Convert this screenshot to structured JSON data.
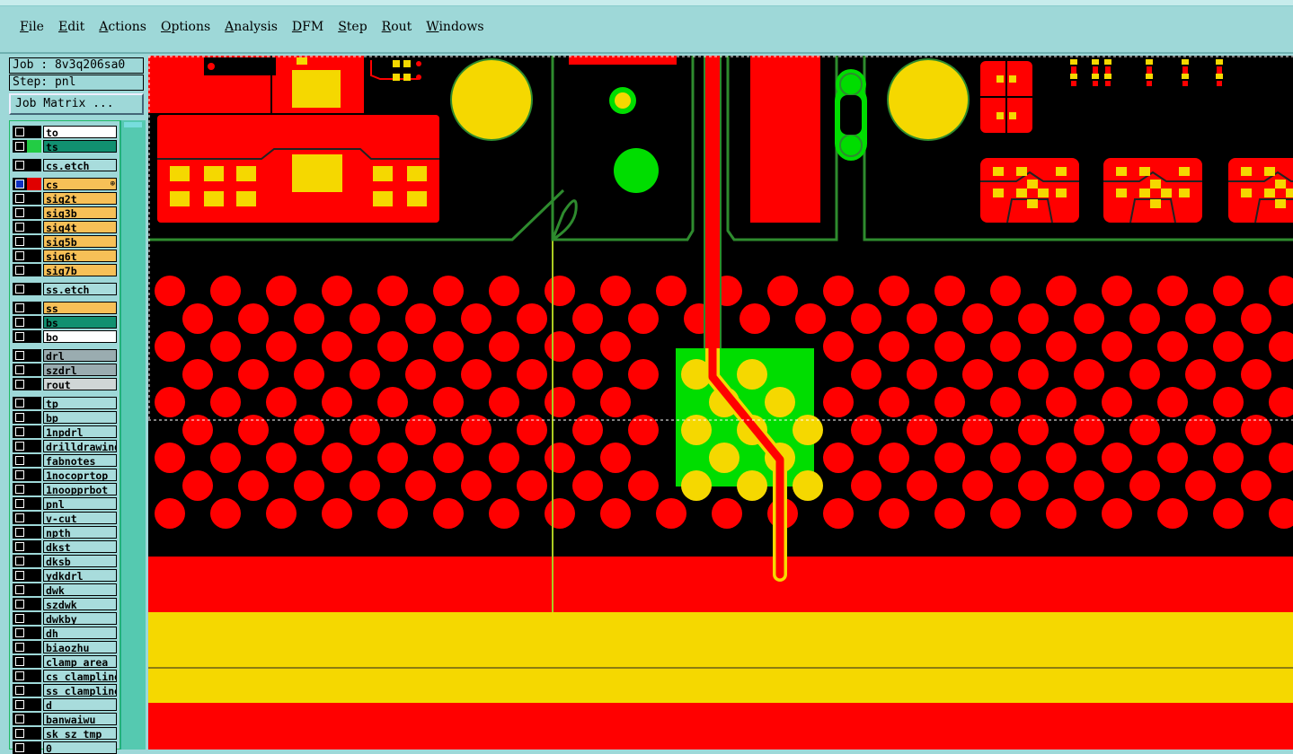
{
  "colors": {
    "copper_red": "#ff0000",
    "pad_yellow": "#f5d800",
    "mask_green": "#00dd00",
    "outline_green": "#2e8b2e",
    "background": "#000000",
    "ui_cyan": "#9ed8d8"
  },
  "menu": [
    "File",
    "Edit",
    "Actions",
    "Options",
    "Analysis",
    "DFM",
    "Step",
    "Rout",
    "Windows"
  ],
  "job": {
    "label": "Job : 8v3q206sa0",
    "step": "Step: pnl",
    "matrix_button": "Job Matrix ..."
  },
  "layers": [
    {
      "name": "to",
      "color": "white"
    },
    {
      "name": "ts",
      "color": "green",
      "swatch": "#22cc44"
    },
    {
      "name": "cs.etch",
      "color": "cyan"
    },
    {
      "name": "cs",
      "color": "orange",
      "swatch": "#e00000",
      "active": true,
      "flag": "⊕"
    },
    {
      "name": "sig2t",
      "color": "orange"
    },
    {
      "name": "sig3b",
      "color": "orange"
    },
    {
      "name": "sig4t",
      "color": "orange"
    },
    {
      "name": "sig5b",
      "color": "orange"
    },
    {
      "name": "sig6t",
      "color": "orange"
    },
    {
      "name": "sig7b",
      "color": "orange"
    },
    {
      "name": "ss.etch",
      "color": "cyan"
    },
    {
      "name": "ss",
      "color": "orange"
    },
    {
      "name": "bs",
      "color": "green"
    },
    {
      "name": "bo",
      "color": "white"
    },
    {
      "name": "drl",
      "color": "gray"
    },
    {
      "name": "szdrl",
      "color": "gray"
    },
    {
      "name": "rout",
      "color": "lgray"
    },
    {
      "name": "tp",
      "color": "cyan"
    },
    {
      "name": "bp",
      "color": "cyan"
    },
    {
      "name": "1npdrl",
      "color": "cyan"
    },
    {
      "name": "drilldrawing",
      "color": "cyan"
    },
    {
      "name": "fabnotes",
      "color": "cyan"
    },
    {
      "name": "1nocoprtop",
      "color": "cyan"
    },
    {
      "name": "1noopprbot",
      "color": "cyan"
    },
    {
      "name": "pnl",
      "color": "cyan"
    },
    {
      "name": "v-cut",
      "color": "cyan"
    },
    {
      "name": "npth",
      "color": "cyan"
    },
    {
      "name": "dkst",
      "color": "cyan"
    },
    {
      "name": "dksb",
      "color": "cyan"
    },
    {
      "name": "ydkdrl",
      "color": "cyan"
    },
    {
      "name": "dwk",
      "color": "cyan"
    },
    {
      "name": "szdwk",
      "color": "cyan"
    },
    {
      "name": "dwkby",
      "color": "cyan"
    },
    {
      "name": "dh",
      "color": "cyan"
    },
    {
      "name": "biaozhu",
      "color": "cyan"
    },
    {
      "name": "clamp_area",
      "color": "cyan"
    },
    {
      "name": "cs_clampline",
      "color": "cyan"
    },
    {
      "name": "ss_clampline",
      "color": "cyan"
    },
    {
      "name": "d",
      "color": "cyan"
    },
    {
      "name": "banwaiwu",
      "color": "cyan"
    },
    {
      "name": "sk_sz_tmp",
      "color": "cyan"
    },
    {
      "name": "0",
      "color": "cyan"
    }
  ]
}
